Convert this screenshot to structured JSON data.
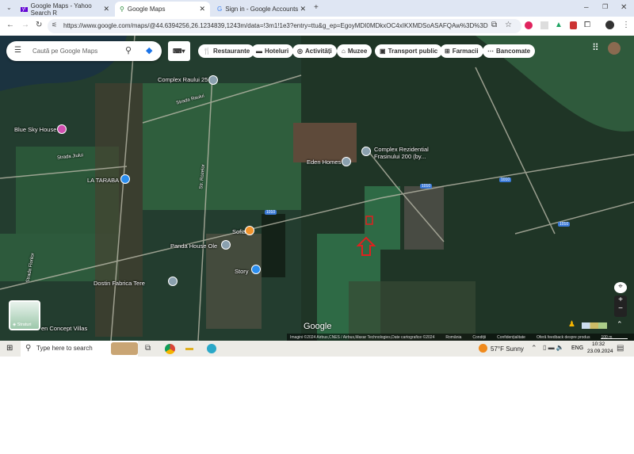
{
  "browser": {
    "tabs": [
      {
        "label": "Google Maps - Yahoo Search R"
      },
      {
        "label": "Google Maps"
      },
      {
        "label": "Sign in - Google Accounts"
      }
    ],
    "url": "https://www.google.com/maps/@44.6394256,26.1234839,1243m/data=!3m1!1e3?entry=ttu&g_ep=EgoyMDI0MDkxOC4xIKXMDSoASAFQAw%3D%3D"
  },
  "maps": {
    "search_placeholder": "Caută pe Google Maps",
    "chips": [
      "Restaurante",
      "Hoteluri",
      "Activități",
      "Muzee",
      "Transport public",
      "Farmacii",
      "Bancomate"
    ],
    "places": [
      "Complex Raului 25",
      "Blue Sky House",
      "LA TARABA",
      "Eden Homes",
      "Complex Rezidential",
      "Frasinului 200  (by...",
      "Sofia",
      "Panda House Ole",
      "Story",
      "Dostin Fabrica Tere",
      "en Concept Villas"
    ],
    "streets": [
      "Strada Raului",
      "Strada Jiului",
      "Str. Rozelor",
      "Strada Florilor"
    ],
    "road_badges": [
      "1010",
      "1010",
      "1010",
      "1010"
    ],
    "layer_label": "Straturi",
    "logo": "Google",
    "attribution": [
      "Imagini ©2024 Airbus,CNES / Airbus,Maxar Technologies,Date cartografice ©2024",
      "România",
      "Condiții",
      "Confidențialitate",
      "Oferă feedback despre produs",
      "100 m"
    ]
  },
  "taskbar": {
    "search": "Type here to search",
    "weather": "57°F  Sunny",
    "lang": "ENG",
    "time": "10:32",
    "date": "23.09.2024"
  }
}
